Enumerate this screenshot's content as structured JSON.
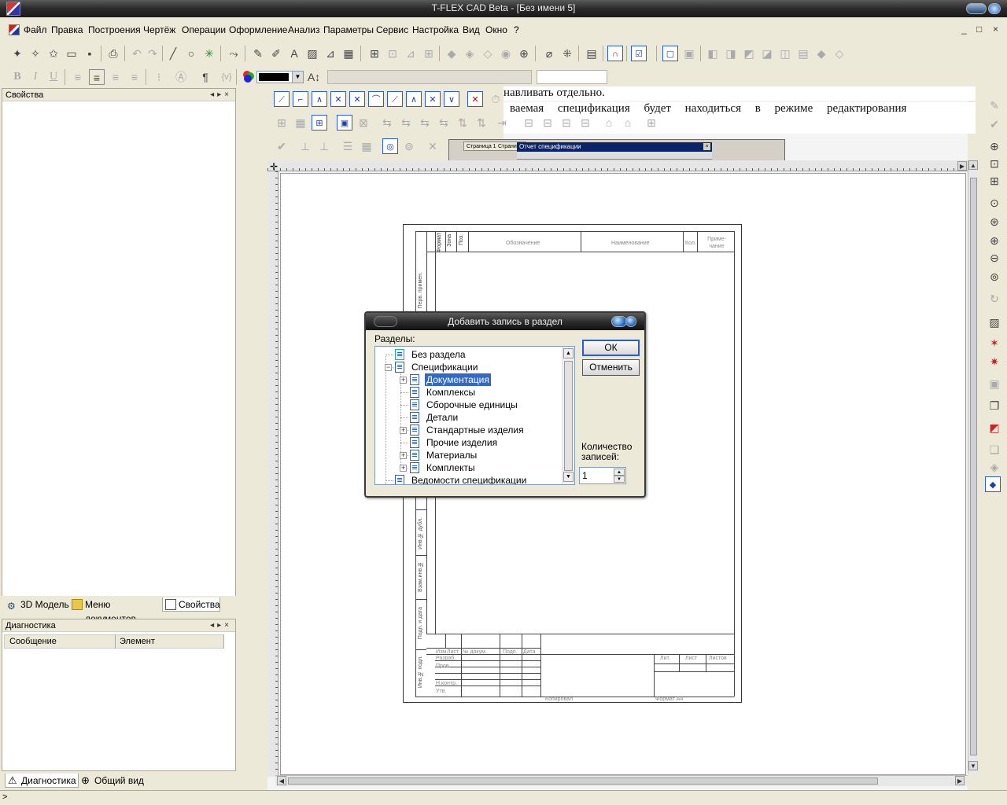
{
  "window": {
    "title": "T-FLEX CAD Beta - [Без имени 5]"
  },
  "menu": [
    "Файл",
    "Правка",
    "Построения",
    "Чертёж",
    "Операции",
    "Оформление",
    "Анализ",
    "Параметры",
    "Сервис",
    "Настройка",
    "Вид",
    "Окно",
    "?"
  ],
  "left_panel": {
    "title": "Свойства",
    "tabs": [
      "3D Модель",
      "Меню документов",
      "Свойства"
    ]
  },
  "diag_panel": {
    "title": "Диагностика",
    "columns": [
      "Сообщение",
      "Элемент"
    ],
    "tabs": [
      "Диагностика",
      "Общий вид"
    ]
  },
  "document": {
    "text_line1": "навливать отдельно.",
    "text_line2": "ваемая спецификация будет находиться в режиме редактирования",
    "mini_tabs": [
      "Страница 1",
      "Страни"
    ],
    "mini_window_title": "Отчет спецификации"
  },
  "sheet": {
    "header_cols": [
      "Формат",
      "Зона",
      "Поз.",
      "Обозначение",
      "Наименование",
      "Кол.",
      "Приме-чание"
    ],
    "left_stamp": [
      "Перв. примен.",
      "Инв.№ дубл.",
      "Взам.инв.№",
      "Подп. и дата",
      "Инв.№ подл."
    ],
    "title_block": [
      "Изм",
      "Лист",
      "№ докум.",
      "Подп.",
      "Дата",
      "Разраб.",
      "Пров.",
      "Н.контр.",
      "Утв.",
      "Лит.",
      "Лист",
      "Листов"
    ],
    "footer_left": "Копировал",
    "footer_right": "Формат А4"
  },
  "dialog": {
    "title": "Добавить запись в раздел",
    "sections_label": "Разделы:",
    "items": [
      {
        "label": "Без раздела"
      },
      {
        "label": "Спецификации"
      },
      {
        "label": "Документация"
      },
      {
        "label": "Комплексы"
      },
      {
        "label": "Сборочные единицы"
      },
      {
        "label": "Детали"
      },
      {
        "label": "Стандартные изделия"
      },
      {
        "label": "Прочие изделия"
      },
      {
        "label": "Материалы"
      },
      {
        "label": "Комплекты"
      },
      {
        "label": "Ведомости спецификации"
      }
    ],
    "ok": "ОК",
    "cancel": "Отменить",
    "count_label_1": "Количество",
    "count_label_2": "записей:",
    "count_value": "1"
  },
  "format_bar": {
    "bold": "B",
    "italic": "I",
    "underline": "U",
    "para": "¶",
    "var": "{v}"
  },
  "statusbar": {
    "text": ">"
  },
  "colors": {
    "selection": "#316ac5",
    "titlebar": "#2a2a2a",
    "accent_blue": "#2a5bd0"
  }
}
